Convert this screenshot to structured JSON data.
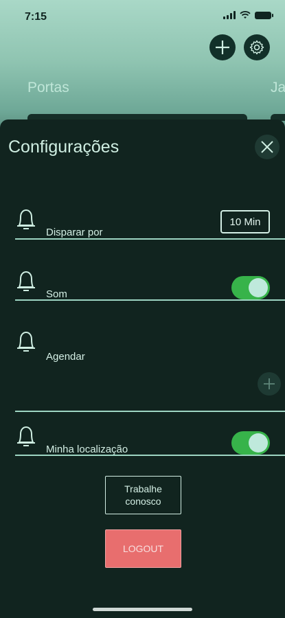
{
  "status_bar": {
    "time": "7:15"
  },
  "header": {
    "tabs": [
      {
        "label": "Portas"
      },
      {
        "label": "Ja"
      }
    ]
  },
  "sheet": {
    "title": "Configurações",
    "rows": {
      "disparar": {
        "label": "Disparar por",
        "value": "10 Min"
      },
      "som": {
        "label": "Som",
        "enabled": true
      },
      "agendar": {
        "label": "Agendar"
      },
      "localizacao": {
        "label": "Minha localização",
        "enabled": true
      }
    },
    "buttons": {
      "work_line1": "Trabalhe",
      "work_line2": "conosco",
      "logout": "LOGOUT"
    }
  },
  "colors": {
    "toggle_on": "#37b34a",
    "logout_bg": "#e86e6e",
    "sheet_bg": "#11241f",
    "accent_line": "#9ed6c3"
  },
  "icons": [
    "wifi-icon",
    "battery-icon",
    "add-icon",
    "gear-icon",
    "close-icon",
    "bell-icon"
  ]
}
